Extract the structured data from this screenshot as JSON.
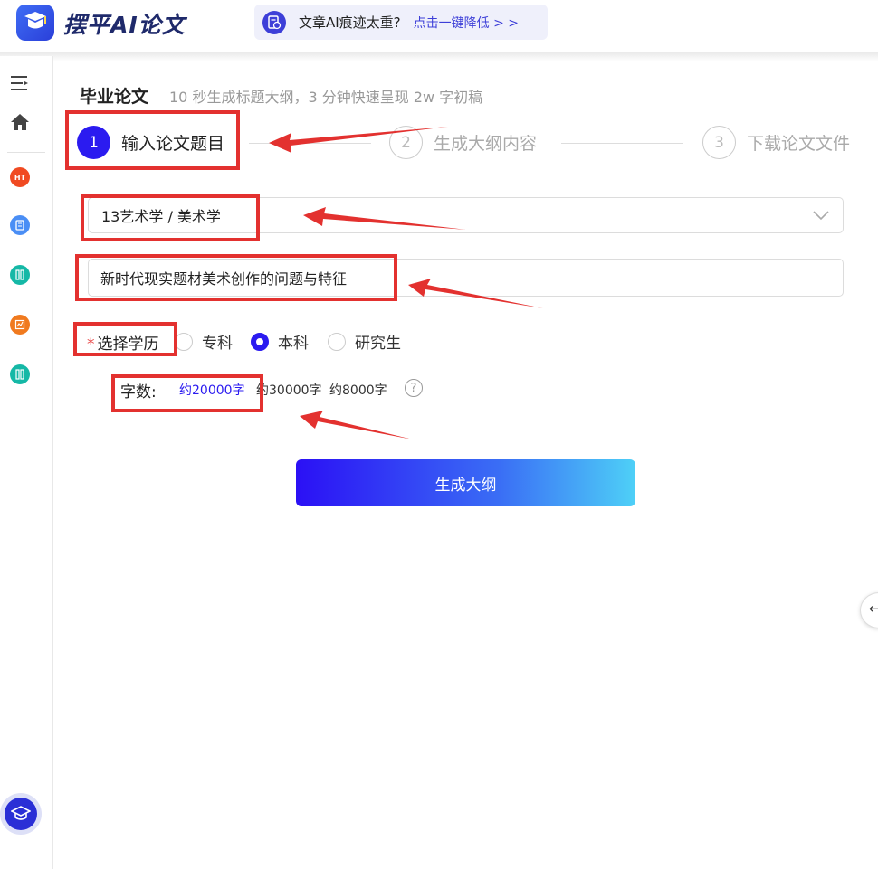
{
  "header": {
    "logo_text": "摆平AI论文",
    "promo_text": "文章AI痕迹太重?",
    "promo_link": "点击一键降低 > >"
  },
  "sidebar": {
    "items": [
      {
        "icon": "menu-icon"
      },
      {
        "icon": "home-icon"
      },
      {
        "icon": "hot-icon",
        "badge": "HT",
        "color": "#f04a22"
      },
      {
        "icon": "document-icon",
        "color": "#4a8ef5"
      },
      {
        "icon": "book-icon",
        "color": "#15b8a6"
      },
      {
        "icon": "report-icon",
        "color": "#f07a1f"
      },
      {
        "icon": "book-icon",
        "color": "#15b8a6"
      },
      {
        "icon": "graduation-cap-icon",
        "color": "#2a2fd6"
      }
    ]
  },
  "page": {
    "title": "毕业论文",
    "subtitle": "10 秒生成标题大纲，3 分钟快速呈现 2w 字初稿"
  },
  "steps": [
    {
      "number": "1",
      "label": "输入论文题目",
      "state": "active"
    },
    {
      "number": "2",
      "label": "生成大纲内容",
      "state": "inactive"
    },
    {
      "number": "3",
      "label": "下载论文文件",
      "state": "inactive"
    }
  ],
  "form": {
    "subject_value": "13艺术学 / 美术学",
    "title_value": "新时代现实题材美术创作的问题与特征",
    "education_label": "选择学历",
    "required_mark": "*",
    "education_options": [
      {
        "label": "专科",
        "checked": false
      },
      {
        "label": "本科",
        "checked": true
      },
      {
        "label": "研究生",
        "checked": false
      }
    ],
    "word_count_label": "字数:",
    "word_count_options": [
      {
        "label": "约20000字",
        "selected": true
      },
      {
        "label": "约30000字",
        "selected": false
      },
      {
        "label": "约8000字",
        "selected": false
      }
    ],
    "help_symbol": "?",
    "submit_label": "生成大纲"
  },
  "side_tab": {
    "icon": "arrow-left-icon",
    "glyph": "←"
  },
  "colors": {
    "accent": "#2b1bf0",
    "annotation_red": "#e3312f",
    "button_gradient": [
      "#2b10f5",
      "#4ed0f7"
    ]
  }
}
